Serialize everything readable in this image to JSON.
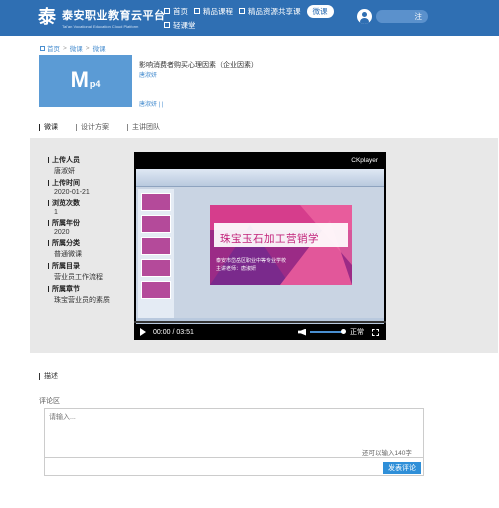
{
  "header": {
    "logo_glyph": "泰",
    "site_title": "泰安职业教育云平台",
    "site_subtitle": "Tai'an Vocational Education Cloud Platform",
    "nav": [
      {
        "label": "首页",
        "active": false
      },
      {
        "label": "精品课程",
        "active": false
      },
      {
        "label": "精品资源共享课",
        "active": false
      },
      {
        "label": "微课",
        "active": true
      },
      {
        "label": "轻课堂",
        "active": false
      }
    ],
    "login_label": "注"
  },
  "breadcrumb": {
    "items": [
      "首页",
      "微课",
      "微课"
    ]
  },
  "course": {
    "thumb_big": "M",
    "thumb_small": "p4",
    "title": "影响消费者购买心理因素（企业因素）",
    "author_link": "唐淑妍",
    "meta_line": "唐淑妍 | |"
  },
  "tabs": [
    {
      "label": "微课",
      "active": true
    },
    {
      "label": "设计方案",
      "active": false
    },
    {
      "label": "主讲团队",
      "active": false
    }
  ],
  "info": [
    {
      "label": "上传人员",
      "value": "唐淑妍"
    },
    {
      "label": "上传时间",
      "value": "2020-01-21"
    },
    {
      "label": "浏览次数",
      "value": "1"
    },
    {
      "label": "所属年份",
      "value": "2020"
    },
    {
      "label": "所属分类",
      "value": "普通微课"
    },
    {
      "label": "所属目录",
      "value": "营业员工作流程"
    },
    {
      "label": "所属章节",
      "value": "珠宝营业员的素质"
    }
  ],
  "player": {
    "brand": "CKplayer",
    "slide_title": "珠宝玉石加工营销学",
    "slide_subtitle_1": "泰安市岱岳区职业中等专业学校",
    "slide_subtitle_2": "主讲老师：唐淑妍",
    "time": "00:00 / 03:51",
    "quality": "正常",
    "progress": 0
  },
  "description": {
    "label": "描述"
  },
  "comments": {
    "label": "评论区",
    "placeholder": "请输入...",
    "remaining": "还可以输入140字",
    "submit_label": "发表评论"
  },
  "colors": {
    "brand_blue": "#2f6fb3",
    "thumb_blue": "#5b9bd5",
    "submit_blue": "#2f8fd8",
    "panel_gray": "#e8e8e8"
  }
}
